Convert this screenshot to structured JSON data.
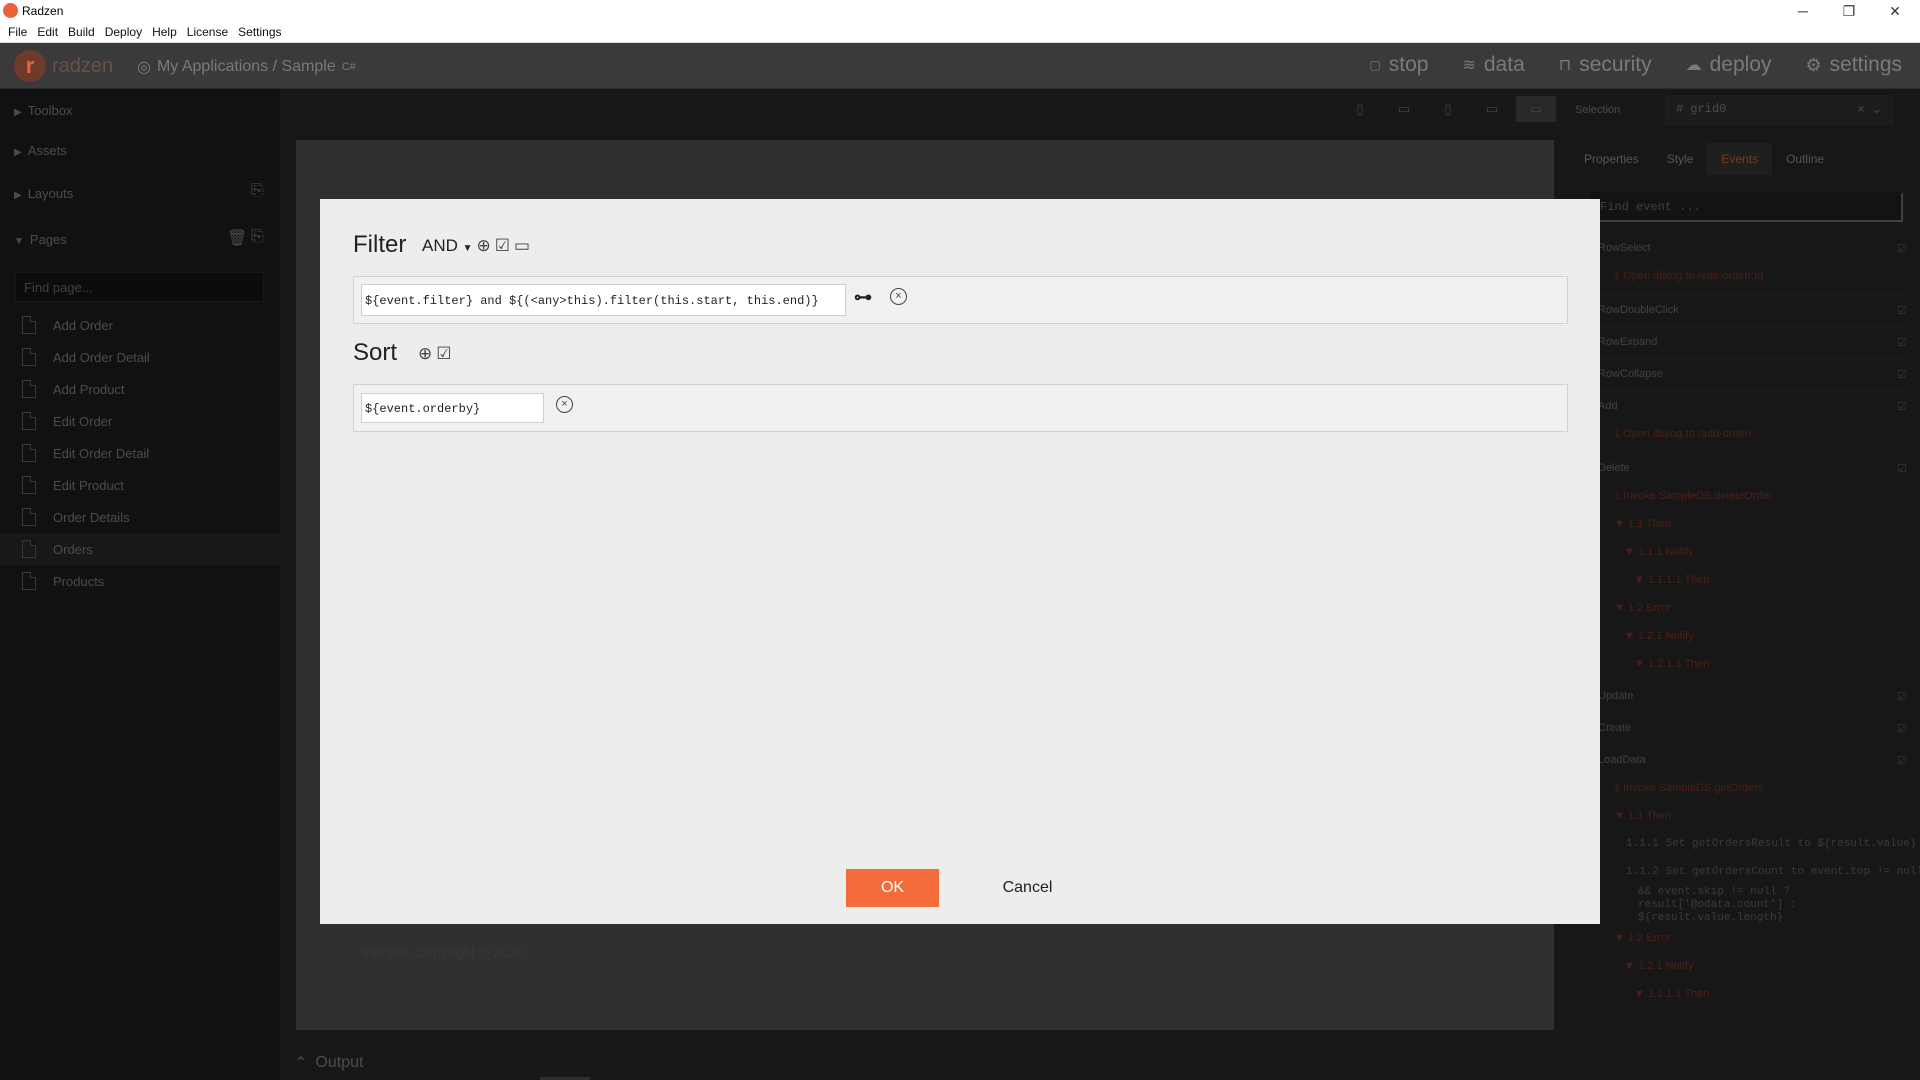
{
  "window": {
    "title": "Radzen",
    "minimize": "─",
    "maximize": "❐",
    "close": "✕"
  },
  "menu": [
    "File",
    "Edit",
    "Build",
    "Deploy",
    "Help",
    "License",
    "Settings"
  ],
  "app": {
    "brand": "radzen",
    "breadcrumb": "My Applications / Sample",
    "lang_badge": "C#",
    "actions": [
      {
        "label": "stop",
        "icon": "stop-icon"
      },
      {
        "label": "data",
        "icon": "layers-icon"
      },
      {
        "label": "security",
        "icon": "lock-icon"
      },
      {
        "label": "deploy",
        "icon": "cloud-upload-icon"
      },
      {
        "label": "settings",
        "icon": "gear-icon"
      }
    ]
  },
  "sidebar": {
    "sections": {
      "toolbox": "Toolbox",
      "assets": "Assets",
      "layouts": "Layouts",
      "pages": "Pages"
    },
    "find_placeholder": "Find page...",
    "pages": [
      "Add Order",
      "Add Order Detail",
      "Add Product",
      "Edit Order",
      "Edit Order Detail",
      "Edit Product",
      "Order Details",
      "Orders",
      "Products"
    ],
    "active_page": "Orders"
  },
  "canvas": {
    "footer": "Sample, Copyright © 2020"
  },
  "output": {
    "label": "Output"
  },
  "right_panel": {
    "selection_label": "Selection",
    "selection_value": "grid0",
    "tabs": [
      "Properties",
      "Style",
      "Events",
      "Outline"
    ],
    "active_tab": "Events",
    "find_event_placeholder": "Find event ...",
    "events": [
      {
        "t": "RowSelect",
        "c": "name"
      },
      {
        "t": "1 Open dialog to /edit-order/:Id",
        "c": "red"
      },
      {
        "t": "RowDoubleClick",
        "c": "name"
      },
      {
        "t": "RowExpand",
        "c": "name"
      },
      {
        "t": "RowCollapse",
        "c": "name"
      },
      {
        "t": "Add",
        "c": "name"
      },
      {
        "t": "1 Open dialog to /add-order/",
        "c": "red"
      },
      {
        "t": "Delete",
        "c": "name"
      },
      {
        "t": "1 Invoke SampleDS.deleteOrder",
        "c": "red"
      },
      {
        "t": "▼ 1.1 Then",
        "c": "red"
      },
      {
        "t": "▼ 1.1.1 Notify",
        "c": "red"
      },
      {
        "t": "▼ 1.1.1.1 Then",
        "c": "red"
      },
      {
        "t": "▼ 1.2 Error",
        "c": "red"
      },
      {
        "t": "▼ 1.2.1 Notify",
        "c": "red"
      },
      {
        "t": "▼ 1.2.1.1 Then",
        "c": "red"
      },
      {
        "t": "Update",
        "c": "name"
      },
      {
        "t": "Create",
        "c": "name"
      },
      {
        "t": "LoadData",
        "c": "name"
      },
      {
        "t": "1 Invoke SampleDS.getOrders",
        "c": "red"
      },
      {
        "t": "▼ 1.1 Then",
        "c": "red"
      },
      {
        "t": "1.1.1 Set getOrdersResult to ${result.value}",
        "c": "code"
      },
      {
        "t": "1.1.2 Set getOrdersCount to event.top != null",
        "c": "code"
      },
      {
        "t": "&& event.skip != null ?",
        "c": "code"
      },
      {
        "t": "result['@odata.count'] :",
        "c": "code"
      },
      {
        "t": "${result.value.length}",
        "c": "code"
      },
      {
        "t": "▼ 1.2 Error",
        "c": "red"
      },
      {
        "t": "▼ 1.2.1 Notify",
        "c": "red"
      },
      {
        "t": "▼ 1.2.1.1 Then",
        "c": "red"
      }
    ]
  },
  "dialog": {
    "filter_title": "Filter",
    "operator": "AND",
    "filter_expression": "${event.filter} and ${(<any>this).filter(this.start, this.end)}",
    "sort_title": "Sort",
    "sort_expression": "${event.orderby}",
    "ok": "OK",
    "cancel": "Cancel"
  },
  "colors": {
    "accent": "#f26b3a",
    "brand": "#e8623a",
    "dark": "#1f1f1f"
  }
}
